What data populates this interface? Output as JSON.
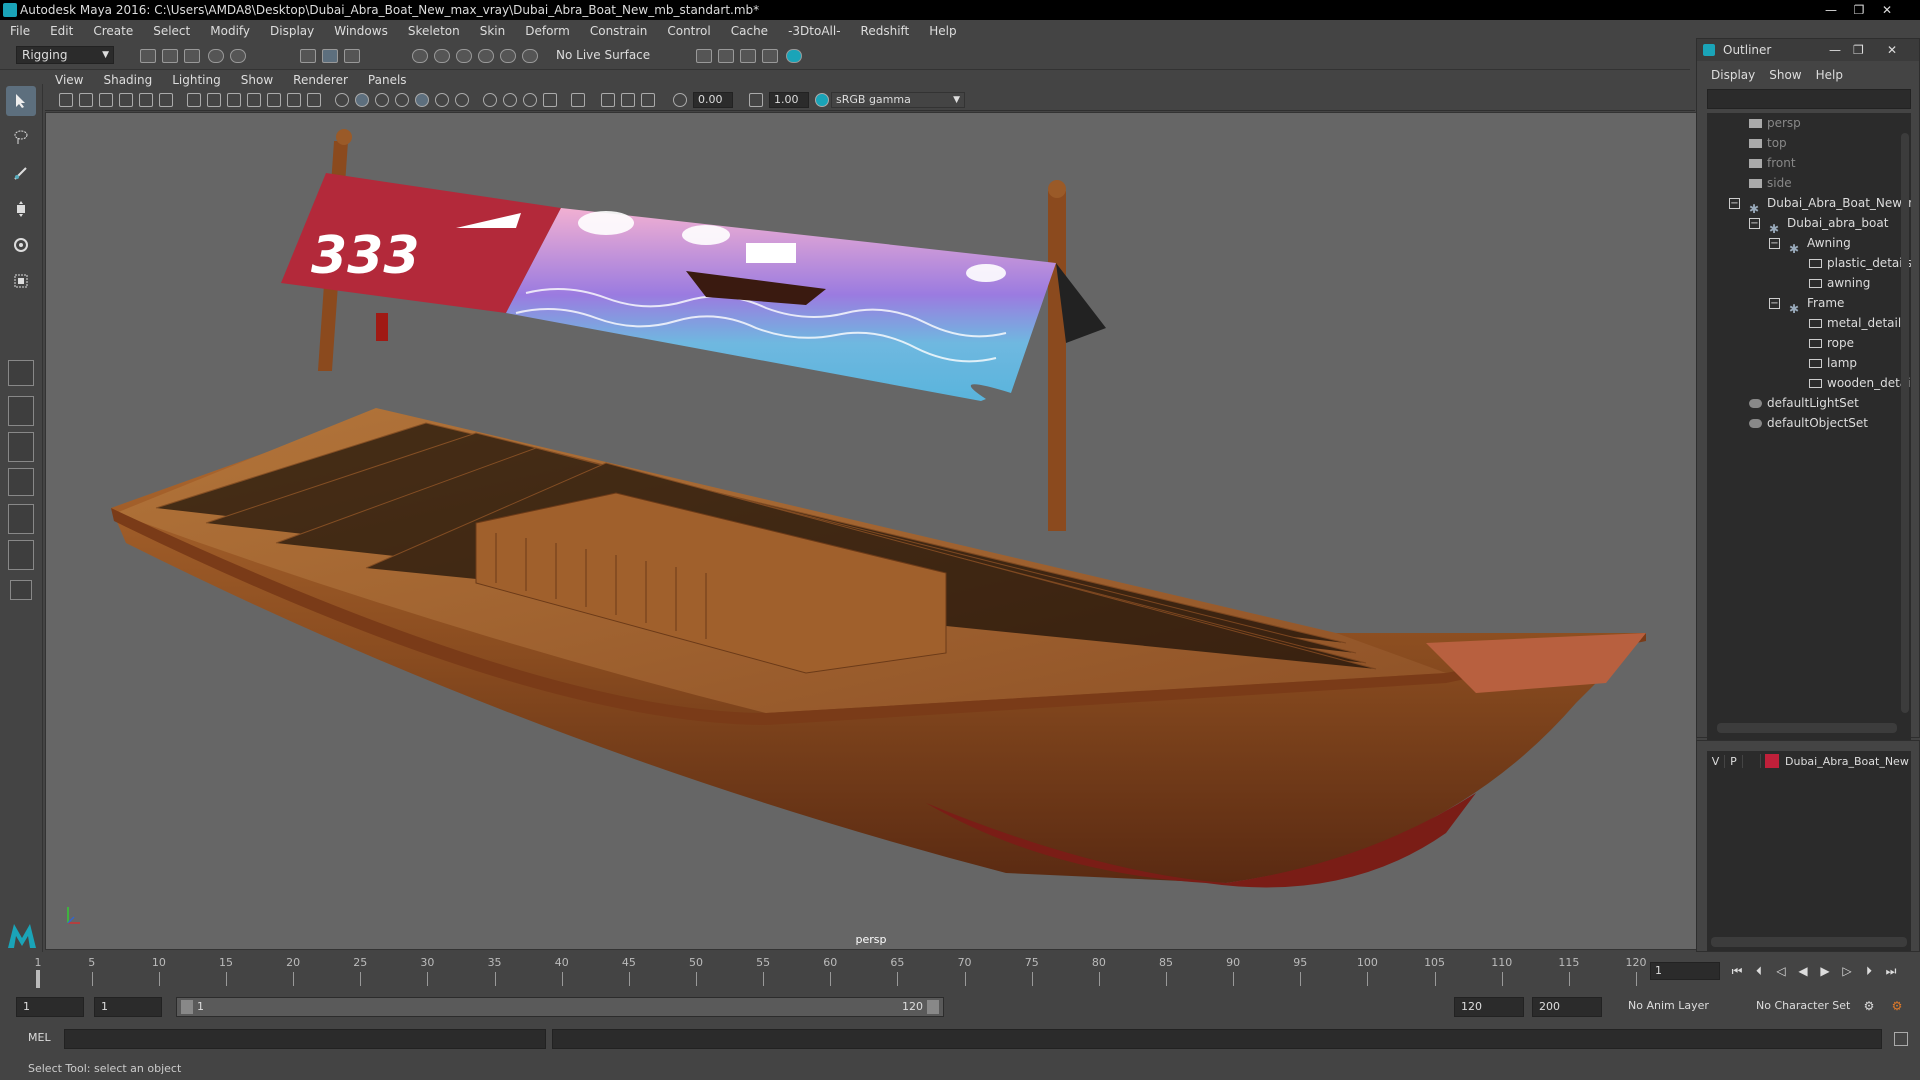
{
  "window": {
    "title": "Autodesk Maya 2016: C:\\Users\\AMDA8\\Desktop\\Dubai_Abra_Boat_New_max_vray\\Dubai_Abra_Boat_New_mb_standart.mb*",
    "controls": [
      "—",
      "❐",
      "✕"
    ]
  },
  "menubar": [
    "File",
    "Edit",
    "Create",
    "Select",
    "Modify",
    "Display",
    "Windows",
    "Skeleton",
    "Skin",
    "Deform",
    "Constrain",
    "Control",
    "Cache",
    "-3DtoAll-",
    "Redshift",
    "Help"
  ],
  "statusline": {
    "mode": "Rigging",
    "live_surface": "No Live Surface"
  },
  "panel": {
    "menus": [
      "View",
      "Shading",
      "Lighting",
      "Show",
      "Renderer",
      "Panels"
    ],
    "exposure": "0.00",
    "gamma": "1.00",
    "colorspace": "sRGB gamma",
    "camera_label": "persp"
  },
  "outliner": {
    "title": "Outliner",
    "menus": [
      "Display",
      "Show",
      "Help"
    ],
    "items": [
      {
        "label": "persp",
        "kind": "camera",
        "dim": true
      },
      {
        "label": "top",
        "kind": "camera",
        "dim": true
      },
      {
        "label": "front",
        "kind": "camera",
        "dim": true
      },
      {
        "label": "side",
        "kind": "camera",
        "dim": true
      },
      {
        "label": "Dubai_Abra_Boat_New_nc",
        "kind": "group"
      },
      {
        "label": "Dubai_abra_boat",
        "kind": "group"
      },
      {
        "label": "Awning",
        "kind": "group"
      },
      {
        "label": "plastic_details",
        "kind": "mesh"
      },
      {
        "label": "awning",
        "kind": "mesh"
      },
      {
        "label": "Frame",
        "kind": "group"
      },
      {
        "label": "metal_details",
        "kind": "mesh"
      },
      {
        "label": "rope",
        "kind": "mesh"
      },
      {
        "label": "lamp",
        "kind": "mesh"
      },
      {
        "label": "wooden_detai",
        "kind": "mesh"
      },
      {
        "label": "defaultLightSet",
        "kind": "set"
      },
      {
        "label": "defaultObjectSet",
        "kind": "set"
      }
    ]
  },
  "layers": {
    "v": "V",
    "p": "P",
    "name": "Dubai_Abra_Boat_New",
    "color": "#c0203a"
  },
  "timeline": {
    "ticks": [
      "1",
      "5",
      "10",
      "15",
      "20",
      "25",
      "30",
      "35",
      "40",
      "45",
      "50",
      "55",
      "60",
      "65",
      "70",
      "75",
      "80",
      "85",
      "90",
      "95",
      "100",
      "105",
      "110",
      "115",
      "120"
    ],
    "current_frame": "1"
  },
  "range": {
    "start": "1",
    "anim_start": "1",
    "slider_start": "1",
    "slider_end": "120",
    "anim_end": "120",
    "end": "200",
    "anim_layer": "No Anim Layer",
    "character_set": "No Character Set"
  },
  "cmdline": {
    "lang": "MEL"
  },
  "helpline": "Select Tool: select an object",
  "scene": {
    "awning_number": "333",
    "wood_color": "#9a5a28",
    "awning_red": "#b3293a"
  }
}
